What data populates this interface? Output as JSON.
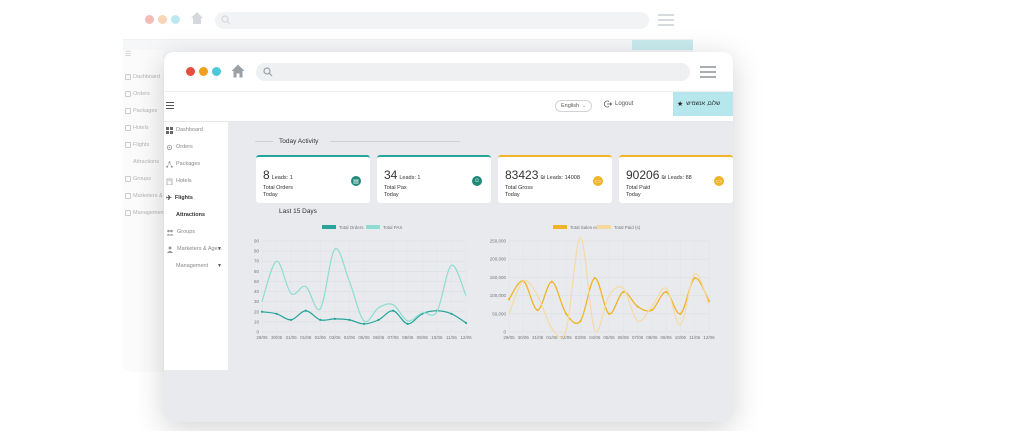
{
  "colors": {
    "dot_red": "#e74c3c",
    "dot_orange": "#f0a020",
    "dot_teal": "#4dc8d8",
    "teal": "#26a69a",
    "teal_light": "#8fdcd2",
    "gold": "#f0b429",
    "gold_light": "#f7d9a0",
    "accent_bg": "#b5e7ec"
  },
  "browser": {
    "home_icon": "home-icon",
    "search_icon": "search-icon",
    "menu_icon": "hamburger-menu-icon"
  },
  "background_window": {
    "sidebar_items": [
      "Dashboard",
      "Orders",
      "Packages",
      "Hotels",
      "Flights",
      "Attractions",
      "Groups",
      "Marketers &",
      "Management"
    ]
  },
  "topbar": {
    "language": "English",
    "logout_label": "Logout",
    "user_name": "שלום, אנשמיש"
  },
  "sidebar": {
    "items": [
      {
        "label": "Dashboard",
        "icon": "grid-icon"
      },
      {
        "label": "Orders",
        "icon": "gear-icon"
      },
      {
        "label": "Packages",
        "icon": "network-icon"
      },
      {
        "label": "Hotels",
        "icon": "building-icon"
      },
      {
        "label": "Flights",
        "icon": "plane-icon"
      },
      {
        "label": "Attractions",
        "icon": ""
      },
      {
        "label": "Groups",
        "icon": "users-icon"
      },
      {
        "label": "Marketers & Age...",
        "icon": "people-icon",
        "chevron": true
      },
      {
        "label": "Management",
        "icon": "",
        "chevron": true
      }
    ]
  },
  "today": {
    "title": "Today Activity",
    "cards": [
      {
        "value": "8",
        "sub": "Leads: 1",
        "label": "Total Orders",
        "period": "Today",
        "icon": "document-icon"
      },
      {
        "value": "34",
        "sub": "Leads: 1",
        "label": "Total Pax",
        "period": "Today",
        "icon": "user-icon"
      },
      {
        "value": "83423",
        "sub": "₪ Leads: 14008",
        "label": "Total Gross",
        "period": "Today",
        "icon": "wallet-icon"
      },
      {
        "value": "90206",
        "sub": "₪ Leads: 88",
        "label": "Total Paid",
        "period": "Today",
        "icon": "wallet-icon"
      }
    ]
  },
  "last15": {
    "title": "Last 15 Days"
  },
  "chart_data": [
    {
      "type": "line",
      "categories": [
        "29/05",
        "30/05",
        "31/05",
        "01/06",
        "02/06",
        "03/06",
        "04/06",
        "05/06",
        "06/06",
        "07/06",
        "08/06",
        "09/06",
        "10/06",
        "11/06",
        "12/06"
      ],
      "series": [
        {
          "name": "Total Orders",
          "values": [
            20,
            18,
            12,
            21,
            12,
            13,
            12,
            8,
            12,
            21,
            8,
            18,
            21,
            18,
            9
          ]
        },
        {
          "name": "Total PAX",
          "values": [
            30,
            70,
            38,
            45,
            23,
            82,
            50,
            11,
            24,
            27,
            11,
            19,
            20,
            66,
            36
          ]
        }
      ],
      "ylim": [
        0,
        90
      ],
      "yticks": [
        0,
        10,
        20,
        30,
        40,
        50,
        60,
        70,
        80,
        90
      ],
      "legend": "top"
    },
    {
      "type": "line",
      "categories": [
        "29/05",
        "30/05",
        "31/05",
        "01/06",
        "02/06",
        "03/06",
        "04/06",
        "05/06",
        "06/06",
        "07/06",
        "08/06",
        "09/06",
        "10/06",
        "11/06",
        "12/06"
      ],
      "series": [
        {
          "name": "Total Sales ex",
          "values": [
            90000,
            140000,
            60000,
            138000,
            50000,
            30000,
            148000,
            50000,
            110000,
            70000,
            60000,
            110000,
            50000,
            148000,
            85000
          ]
        },
        {
          "name": "Total Paid (s)",
          "values": [
            50000,
            140000,
            100000,
            10000,
            5000,
            260000,
            5000,
            100000,
            120000,
            30000,
            70000,
            120000,
            20000,
            160000,
            75000
          ]
        }
      ],
      "ylim": [
        0,
        250000
      ],
      "yticks": [
        0,
        50000,
        100000,
        150000,
        200000,
        250000
      ],
      "ytick_labels": [
        "0",
        "50,000",
        "100,000",
        "150,000",
        "200,000",
        "250,000"
      ],
      "legend": "top"
    }
  ]
}
